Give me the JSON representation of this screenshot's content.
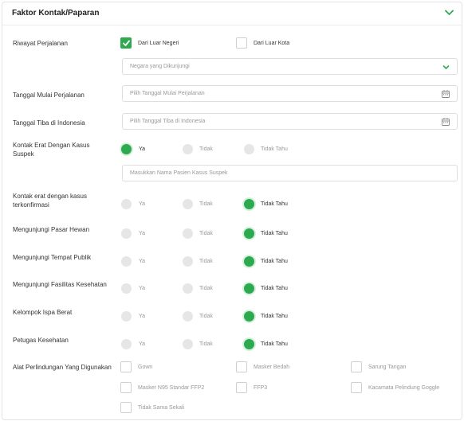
{
  "header": {
    "title": "Faktor Kontak/Paparan"
  },
  "travel": {
    "label": "Riwayat Perjalanan",
    "abroad": "Dari Luar Negeri",
    "domestic": "Dari Luar Kota",
    "country_placeholder": "Negara yang Dikunjungi"
  },
  "start_date": {
    "label": "Tanggal Mulai Perjalanan",
    "placeholder": "Pilih Tanggal Mulai Perjalanan"
  },
  "arrival_date": {
    "label": "Tanggal Tiba di Indonesia",
    "placeholder": "Pilih Tanggal Tiba di Indonesia"
  },
  "options": {
    "yes": "Ya",
    "no": "Tidak",
    "unknown": "Tidak Tahu"
  },
  "suspect": {
    "label": "Kontak Erat Dengan Kasus Suspek",
    "patient_placeholder": "Masukkan Nama Pasien Kasus Suspek"
  },
  "questions": [
    {
      "label": "Kontak erat dengan kasus terkonfirmasi"
    },
    {
      "label": "Mengunjungi Pasar Hewan"
    },
    {
      "label": "Mengunjungi Tempat Publik"
    },
    {
      "label": "Mengunjungi Fasilitas Kesehatan"
    },
    {
      "label": "Kelompok Ispa Berat"
    },
    {
      "label": "Petugas Kesehatan"
    }
  ],
  "ppe": {
    "label": "Alat Perlindungan Yang Digunakan",
    "items": [
      "Gown",
      "Masker Bedah",
      "Sarung Tangan",
      "Masker N95 Standar FFP2",
      "FFP3",
      "Kacamata Pelindung Goggle",
      "Tidak Sama Sekali"
    ]
  },
  "colors": {
    "accent": "#2daa4f"
  }
}
